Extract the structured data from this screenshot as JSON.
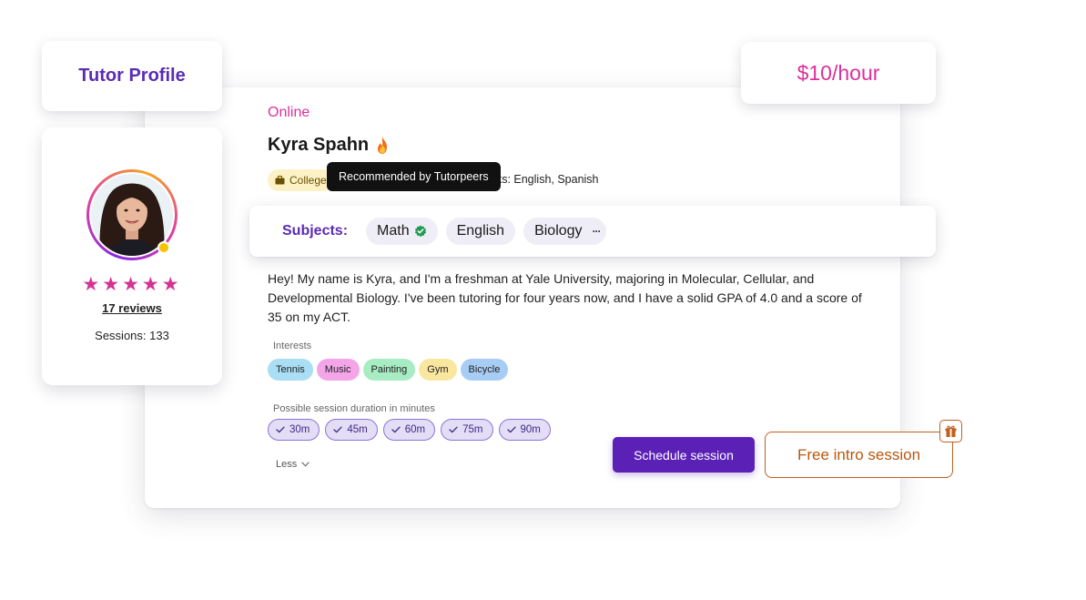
{
  "header": {
    "title": "Tutor Profile",
    "price": "$10/hour"
  },
  "tutor": {
    "status": "Online",
    "name": "Kyra Spahn",
    "badge": "College",
    "tooltip": "Recommended by Tutorpeers",
    "speaks": "aks: English, Spanish",
    "rating_stars": "★★★★★",
    "rating_value": 5,
    "reviews": "17 reviews",
    "sessions": "Sessions: 133"
  },
  "subjects": {
    "label": "Subjects:",
    "items": [
      "Math",
      "English",
      "Biology"
    ],
    "more": "···"
  },
  "bio": "Hey! My name is Kyra, and I'm a freshman at Yale University, majoring in Molecular, Cellular, and Developmental Biology. I've been tutoring for four years now, and I have a solid GPA of 4.0 and a score of 35 on my ACT.",
  "interests": {
    "label": "Interests",
    "items": [
      {
        "label": "Tennis",
        "color": "#a9def5"
      },
      {
        "label": "Music",
        "color": "#f4a5e8"
      },
      {
        "label": "Painting",
        "color": "#a7ecc2"
      },
      {
        "label": "Gym",
        "color": "#f9e7a0"
      },
      {
        "label": "Bicycle",
        "color": "#a8cdf5"
      }
    ]
  },
  "durations": {
    "label": "Possible session duration in minutes",
    "items": [
      "30m",
      "45m",
      "60m",
      "75m",
      "90m"
    ]
  },
  "less_label": "Less",
  "actions": {
    "schedule": "Schedule session",
    "intro": "Free intro session"
  },
  "colors": {
    "brand_purple": "#5b21b6",
    "accent_pink": "#dc2f9d",
    "intro_orange": "#c15f1c",
    "star": "#d43393"
  }
}
